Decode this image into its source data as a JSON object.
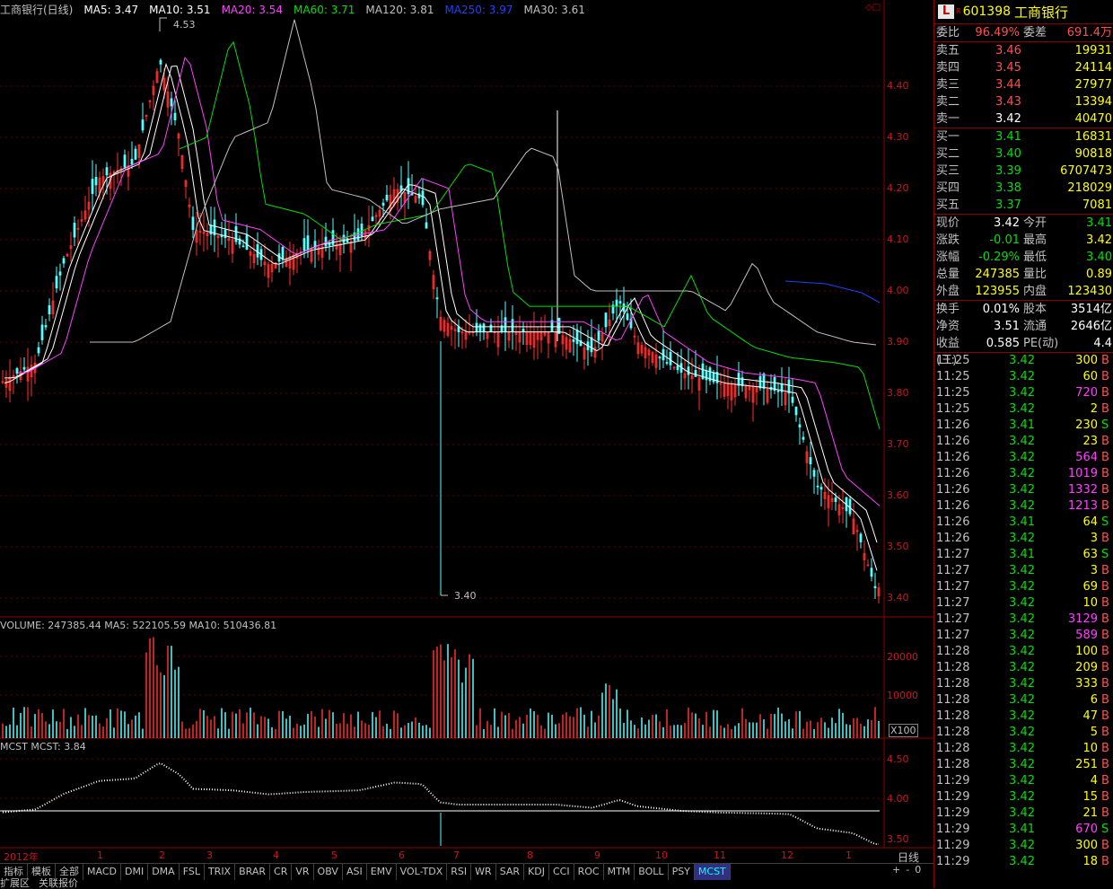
{
  "header": {
    "title": "工商银行(日线)",
    "items": [
      {
        "label": "MA5: 3.47",
        "color": "#ffffff"
      },
      {
        "label": "MA10: 3.51",
        "color": "#ffffff"
      },
      {
        "label": "MA20: 3.54",
        "color": "#ff40ff"
      },
      {
        "label": "MA60: 3.71",
        "color": "#00e000"
      },
      {
        "label": "MA120: 3.81",
        "color": "#c0c0c0"
      },
      {
        "label": "MA250: 3.97",
        "color": "#2040ff"
      },
      {
        "label": "MA30: 3.61",
        "color": "#c0c0c0"
      }
    ]
  },
  "price_axis": [
    "4.40",
    "4.30",
    "4.20",
    "4.10",
    "4.00",
    "3.90",
    "3.80",
    "3.70",
    "3.60",
    "3.50",
    "3.40"
  ],
  "annotations": {
    "high": "4.53",
    "low": "3.40"
  },
  "volume_header": "VOLUME: 247385.44  MA5: 522105.59  MA10: 510436.81",
  "volume_axis": [
    "20000",
    "10000"
  ],
  "volume_unit": "X100",
  "mcst_header": "MCST  MCST: 3.84",
  "mcst_axis": [
    "4.50",
    "4.00",
    "3.50"
  ],
  "x_axis": [
    "2012年",
    "1",
    "2",
    "3",
    "4",
    "5",
    "6",
    "7",
    "8",
    "9",
    "10",
    "11",
    "12",
    "1"
  ],
  "period_label": "日线",
  "tabs": [
    "指标",
    "模板",
    "全部",
    "MACD",
    "DMI",
    "DMA",
    "FSL",
    "TRIX",
    "BRAR",
    "CR",
    "VR",
    "OBV",
    "ASI",
    "EMV",
    "VOL-TDX",
    "RSI",
    "WR",
    "SAR",
    "KDJ",
    "CCI",
    "ROC",
    "MTM",
    "BOLL",
    "PSY",
    "MCST"
  ],
  "active_tab": "MCST",
  "bottom_row": [
    "扩展区",
    "关联报价"
  ],
  "stock": {
    "code": "601398",
    "name": "工商银行",
    "logo": "L",
    "logo_sup": "R"
  },
  "weibi": {
    "label1": "委比",
    "value1": "96.49%",
    "label2": "委差",
    "value2": "691.4万"
  },
  "asks": [
    {
      "label": "卖五",
      "price": "3.46",
      "vol": "19931"
    },
    {
      "label": "卖四",
      "price": "3.45",
      "vol": "24114"
    },
    {
      "label": "卖三",
      "price": "3.44",
      "vol": "27977"
    },
    {
      "label": "卖二",
      "price": "3.43",
      "vol": "13394"
    },
    {
      "label": "卖一",
      "price": "3.42",
      "vol": "40470"
    }
  ],
  "bids": [
    {
      "label": "买一",
      "price": "3.41",
      "vol": "16831"
    },
    {
      "label": "买二",
      "price": "3.40",
      "vol": "90818"
    },
    {
      "label": "买三",
      "price": "3.39",
      "vol": "6707473"
    },
    {
      "label": "买四",
      "price": "3.38",
      "vol": "218029"
    },
    {
      "label": "买五",
      "price": "3.37",
      "vol": "7081"
    }
  ],
  "quote": [
    {
      "l1": "现价",
      "v1": "3.42",
      "l2": "今开",
      "v2": "3.41"
    },
    {
      "l1": "涨跌",
      "v1": "-0.01",
      "l2": "最高",
      "v2": "3.42"
    },
    {
      "l1": "涨幅",
      "v1": "-0.29%",
      "l2": "最低",
      "v2": "3.40"
    },
    {
      "l1": "总量",
      "v1": "247385",
      "l2": "量比",
      "v2": "0.89"
    },
    {
      "l1": "外盘",
      "v1": "123955",
      "l2": "内盘",
      "v2": "123430"
    }
  ],
  "fin": [
    {
      "l1": "换手",
      "v1": "0.01%",
      "l2": "股本",
      "v2": "3514亿"
    },
    {
      "l1": "净资",
      "v1": "3.51",
      "l2": "流通",
      "v2": "2646亿"
    },
    {
      "l1": "收益(三)",
      "v1": "0.585",
      "l2": "PE(动)",
      "v2": "4.4"
    }
  ],
  "ticks": [
    {
      "t": "11:25",
      "p": "3.42",
      "v": "300",
      "d": "B"
    },
    {
      "t": "11:25",
      "p": "3.42",
      "v": "60",
      "d": "B"
    },
    {
      "t": "11:25",
      "p": "3.42",
      "v": "720",
      "d": "B"
    },
    {
      "t": "11:25",
      "p": "3.42",
      "v": "2",
      "d": "B"
    },
    {
      "t": "11:26",
      "p": "3.41",
      "v": "230",
      "d": "S"
    },
    {
      "t": "11:26",
      "p": "3.42",
      "v": "23",
      "d": "B"
    },
    {
      "t": "11:26",
      "p": "3.42",
      "v": "564",
      "d": "B"
    },
    {
      "t": "11:26",
      "p": "3.42",
      "v": "1019",
      "d": "B"
    },
    {
      "t": "11:26",
      "p": "3.42",
      "v": "1332",
      "d": "B"
    },
    {
      "t": "11:26",
      "p": "3.42",
      "v": "1213",
      "d": "B"
    },
    {
      "t": "11:26",
      "p": "3.41",
      "v": "64",
      "d": "S"
    },
    {
      "t": "11:26",
      "p": "3.42",
      "v": "3",
      "d": "B"
    },
    {
      "t": "11:27",
      "p": "3.41",
      "v": "63",
      "d": "S"
    },
    {
      "t": "11:27",
      "p": "3.42",
      "v": "3",
      "d": "B"
    },
    {
      "t": "11:27",
      "p": "3.42",
      "v": "69",
      "d": "B"
    },
    {
      "t": "11:27",
      "p": "3.42",
      "v": "10",
      "d": "B"
    },
    {
      "t": "11:27",
      "p": "3.42",
      "v": "3129",
      "d": "B"
    },
    {
      "t": "11:27",
      "p": "3.42",
      "v": "589",
      "d": "B"
    },
    {
      "t": "11:28",
      "p": "3.42",
      "v": "100",
      "d": "B"
    },
    {
      "t": "11:28",
      "p": "3.42",
      "v": "209",
      "d": "B"
    },
    {
      "t": "11:28",
      "p": "3.42",
      "v": "333",
      "d": "B"
    },
    {
      "t": "11:28",
      "p": "3.42",
      "v": "6",
      "d": "B"
    },
    {
      "t": "11:28",
      "p": "3.42",
      "v": "47",
      "d": "B"
    },
    {
      "t": "11:28",
      "p": "3.42",
      "v": "5",
      "d": "B"
    },
    {
      "t": "11:28",
      "p": "3.42",
      "v": "10",
      "d": "B"
    },
    {
      "t": "11:28",
      "p": "3.42",
      "v": "251",
      "d": "B"
    },
    {
      "t": "11:29",
      "p": "3.42",
      "v": "4",
      "d": "B"
    },
    {
      "t": "11:29",
      "p": "3.42",
      "v": "15",
      "d": "B"
    },
    {
      "t": "11:29",
      "p": "3.42",
      "v": "21",
      "d": "B"
    },
    {
      "t": "11:29",
      "p": "3.41",
      "v": "670",
      "d": "S"
    },
    {
      "t": "11:29",
      "p": "3.42",
      "v": "300",
      "d": "B"
    },
    {
      "t": "11:29",
      "p": "3.42",
      "v": "18",
      "d": "B"
    }
  ]
}
